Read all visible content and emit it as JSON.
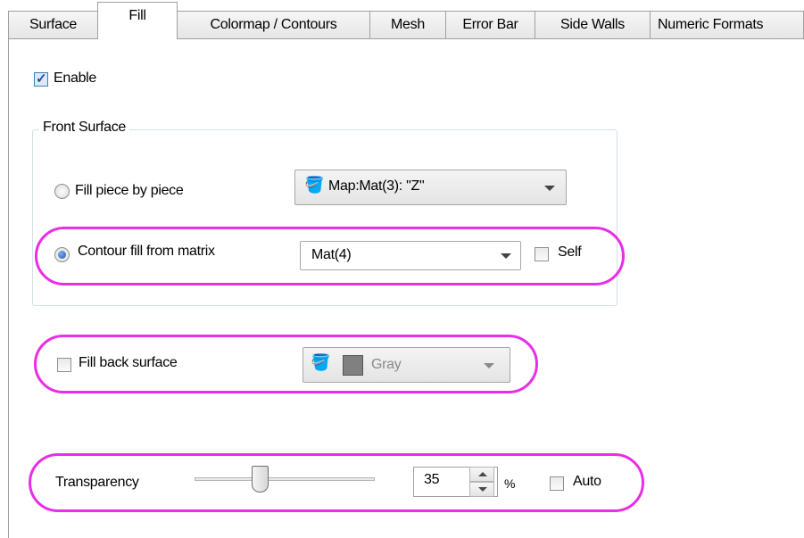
{
  "tabs": [
    {
      "label": "Surface",
      "active": false
    },
    {
      "label": "Fill",
      "active": true
    },
    {
      "label": "Colormap / Contours",
      "active": false
    },
    {
      "label": "Mesh",
      "active": false
    },
    {
      "label": "Error Bar",
      "active": false
    },
    {
      "label": "Side Walls",
      "active": false
    },
    {
      "label": "Numeric Formats",
      "active": false
    }
  ],
  "enable": {
    "label": "Enable",
    "checked": true
  },
  "front_surface": {
    "title": "Front Surface",
    "fill_piece": {
      "label": "Fill piece by piece",
      "selected": false,
      "dropdown_value": "Map:Mat(3): \"Z\""
    },
    "contour_fill": {
      "label": "Contour fill from matrix",
      "selected": true,
      "dropdown_value": "Mat(4)"
    },
    "self": {
      "label": "Self",
      "checked": false
    }
  },
  "back_surface": {
    "label": "Fill back surface",
    "checked": false,
    "color_value": "Gray",
    "color_hex": "#808080"
  },
  "transparency": {
    "label": "Transparency",
    "value": "35",
    "unit": "%",
    "slider_percent": 35
  },
  "auto": {
    "label": "Auto",
    "checked": false
  },
  "highlight_color": "#e82ee6"
}
